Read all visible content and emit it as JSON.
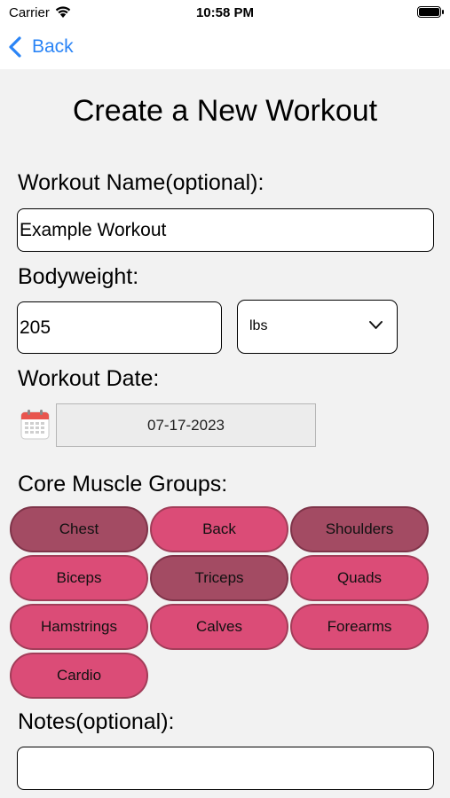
{
  "status_bar": {
    "carrier": "Carrier",
    "time": "10:58 PM"
  },
  "nav": {
    "back_label": "Back"
  },
  "page_title": "Create a New Workout",
  "workout_name": {
    "label": "Workout Name(optional):",
    "value": "Example Workout"
  },
  "bodyweight": {
    "label": "Bodyweight:",
    "value": "205",
    "unit": "lbs"
  },
  "workout_date": {
    "label": "Workout Date:",
    "value": "07-17-2023"
  },
  "muscle_groups": {
    "label": "Core Muscle Groups:",
    "items": [
      {
        "label": "Chest",
        "selected": true
      },
      {
        "label": "Back",
        "selected": false
      },
      {
        "label": "Shoulders",
        "selected": true
      },
      {
        "label": "Biceps",
        "selected": false
      },
      {
        "label": "Triceps",
        "selected": true
      },
      {
        "label": "Quads",
        "selected": false
      },
      {
        "label": "Hamstrings",
        "selected": false
      },
      {
        "label": "Calves",
        "selected": false
      },
      {
        "label": "Forearms",
        "selected": false
      },
      {
        "label": "Cardio",
        "selected": false
      }
    ]
  },
  "notes": {
    "label": "Notes(optional):",
    "value": ""
  },
  "colors": {
    "accent": "#2a84f6",
    "muscle_unselected": "#db4c77",
    "muscle_selected": "#a34b63",
    "background": "#f2f2f2"
  },
  "icons": {
    "back": "chevron-left-icon",
    "wifi": "wifi-icon",
    "battery": "battery-icon",
    "calendar": "calendar-icon",
    "dropdown": "chevron-down-icon"
  }
}
